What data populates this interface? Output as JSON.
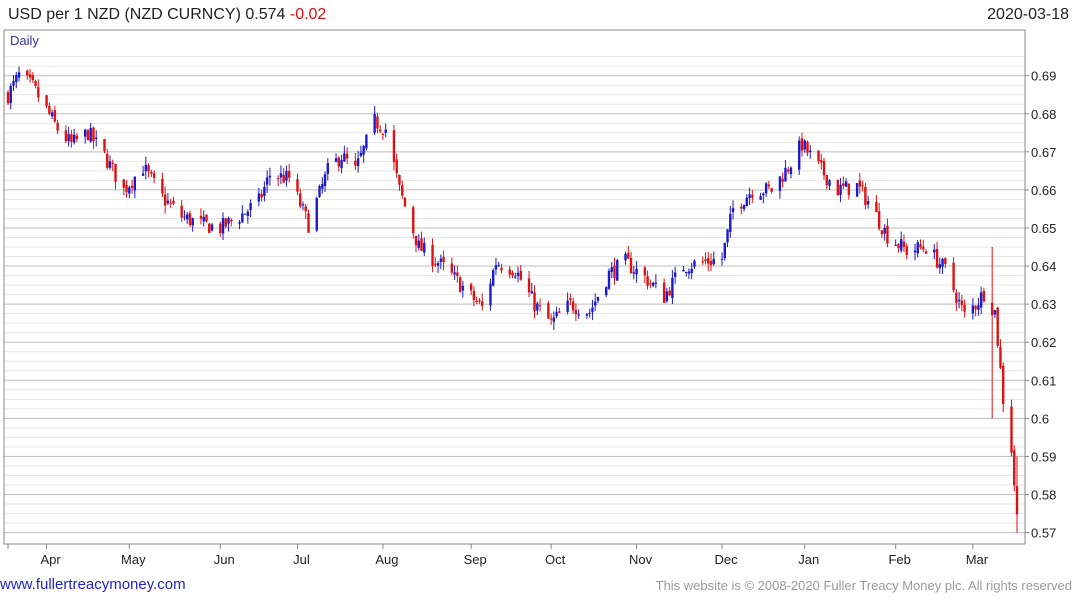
{
  "header": {
    "title": "USD per 1 NZD (NZD CURNCY)",
    "last": "0.574",
    "change": "-0.02",
    "date": "2020-03-18"
  },
  "footer": {
    "url": "www.fullertreacymoney.com",
    "copyright": "This website is © 2008-2020 Fuller Treacy Money plc. All rights reserved"
  },
  "colors": {
    "up": "#1a1acc",
    "down": "#dd1111",
    "grid": "#cfcfcf",
    "frame": "#888888"
  },
  "chart_data": {
    "type": "candlestick",
    "period_label": "Daily",
    "ylim": [
      0.567,
      0.702
    ],
    "y_ticks": [
      0.57,
      0.58,
      0.59,
      0.6,
      0.61,
      0.62,
      0.63,
      0.64,
      0.65,
      0.66,
      0.67,
      0.68,
      0.69
    ],
    "y_tick_labels": [
      "0.57",
      "0.58",
      "0.59",
      "0.6",
      "0.61",
      "0.62",
      "0.63",
      "0.64",
      "0.65",
      "0.66",
      "0.67",
      "0.68",
      "0.69"
    ],
    "x_range": [
      "2019-03-18",
      "2020-03-18"
    ],
    "x_ticks": [
      {
        "date": "2019-04-01",
        "label": "Apr"
      },
      {
        "date": "2019-05-01",
        "label": "May"
      },
      {
        "date": "2019-06-03",
        "label": "Jun"
      },
      {
        "date": "2019-07-01",
        "label": "Jul"
      },
      {
        "date": "2019-08-01",
        "label": "Aug"
      },
      {
        "date": "2019-09-02",
        "label": "Sep"
      },
      {
        "date": "2019-10-01",
        "label": "Oct"
      },
      {
        "date": "2019-11-01",
        "label": "Nov"
      },
      {
        "date": "2019-12-02",
        "label": "Dec"
      },
      {
        "date": "2020-01-01",
        "label": "Jan"
      },
      {
        "date": "2020-02-03",
        "label": "Feb"
      },
      {
        "date": "2020-03-02",
        "label": "Mar"
      }
    ],
    "close_series": {
      "dates": [
        "2019-03-18",
        "2019-03-22",
        "2019-03-27",
        "2019-04-01",
        "2019-04-05",
        "2019-04-10",
        "2019-04-16",
        "2019-04-22",
        "2019-04-29",
        "2019-05-06",
        "2019-05-13",
        "2019-05-20",
        "2019-05-27",
        "2019-06-03",
        "2019-06-10",
        "2019-06-17",
        "2019-06-21",
        "2019-06-28",
        "2019-07-05",
        "2019-07-12",
        "2019-07-17",
        "2019-07-22",
        "2019-07-29",
        "2019-08-02",
        "2019-08-07",
        "2019-08-14",
        "2019-08-21",
        "2019-08-28",
        "2019-09-02",
        "2019-09-06",
        "2019-09-11",
        "2019-09-18",
        "2019-09-25",
        "2019-10-01",
        "2019-10-08",
        "2019-10-15",
        "2019-10-22",
        "2019-10-28",
        "2019-11-04",
        "2019-11-11",
        "2019-11-18",
        "2019-11-25",
        "2019-12-02",
        "2019-12-06",
        "2019-12-13",
        "2019-12-20",
        "2019-12-26",
        "2019-12-31",
        "2020-01-06",
        "2020-01-13",
        "2020-01-20",
        "2020-01-24",
        "2020-01-31",
        "2020-02-07",
        "2020-02-14",
        "2020-02-21",
        "2020-02-28",
        "2020-03-03",
        "2020-03-06",
        "2020-03-10",
        "2020-03-13",
        "2020-03-16",
        "2020-03-18"
      ],
      "values": [
        0.685,
        0.69,
        0.687,
        0.681,
        0.676,
        0.672,
        0.675,
        0.669,
        0.66,
        0.666,
        0.658,
        0.653,
        0.651,
        0.65,
        0.653,
        0.657,
        0.664,
        0.663,
        0.651,
        0.665,
        0.669,
        0.665,
        0.678,
        0.676,
        0.66,
        0.645,
        0.641,
        0.636,
        0.632,
        0.629,
        0.641,
        0.639,
        0.63,
        0.625,
        0.63,
        0.628,
        0.638,
        0.641,
        0.637,
        0.632,
        0.64,
        0.641,
        0.642,
        0.655,
        0.66,
        0.66,
        0.666,
        0.672,
        0.666,
        0.66,
        0.661,
        0.657,
        0.648,
        0.644,
        0.645,
        0.639,
        0.627,
        0.63,
        0.633,
        0.628,
        0.605,
        0.592,
        0.574
      ]
    },
    "spikes": [
      {
        "date": "2020-03-09",
        "high": 0.645,
        "low": 0.6
      },
      {
        "date": "2020-03-18",
        "high": 0.59,
        "low": 0.57
      }
    ]
  }
}
